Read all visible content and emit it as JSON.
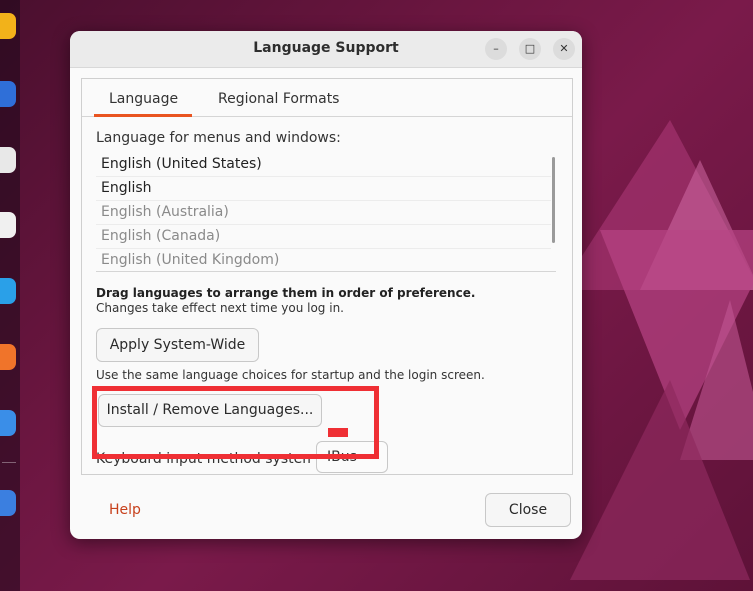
{
  "window": {
    "title": "Language Support",
    "controls": {
      "minimize": "–",
      "maximize": "□",
      "close": "✕"
    }
  },
  "tabs": [
    {
      "label": "Language",
      "active": true
    },
    {
      "label": "Regional Formats",
      "active": false
    }
  ],
  "language_tab": {
    "list_label": "Language for menus and windows:",
    "languages": [
      {
        "name": "English (United States)",
        "enabled": true
      },
      {
        "name": "English",
        "enabled": true
      },
      {
        "name": "English (Australia)",
        "enabled": false
      },
      {
        "name": "English (Canada)",
        "enabled": false
      },
      {
        "name": "English (United Kingdom)",
        "enabled": false
      }
    ],
    "drag_hint": "Drag languages to arrange them in order of preference.",
    "change_hint": "Changes take effect next time you log in.",
    "apply_button": "Apply System-Wide",
    "system_note": "Use the same language choices for startup and the login screen.",
    "install_button": "Install / Remove Languages...",
    "keyboard_label": "Keyboard input method system:",
    "keyboard_value": "IBus"
  },
  "footer": {
    "help": "Help",
    "close": "Close"
  },
  "colors": {
    "accent": "#e95420",
    "annotation": "#ef2f34",
    "link": "#c7411c"
  },
  "icons": {
    "dock": [
      "firefox-icon",
      "thunderbird-icon",
      "files-icon",
      "software-icon",
      "help-icon",
      "settings-icon"
    ]
  }
}
